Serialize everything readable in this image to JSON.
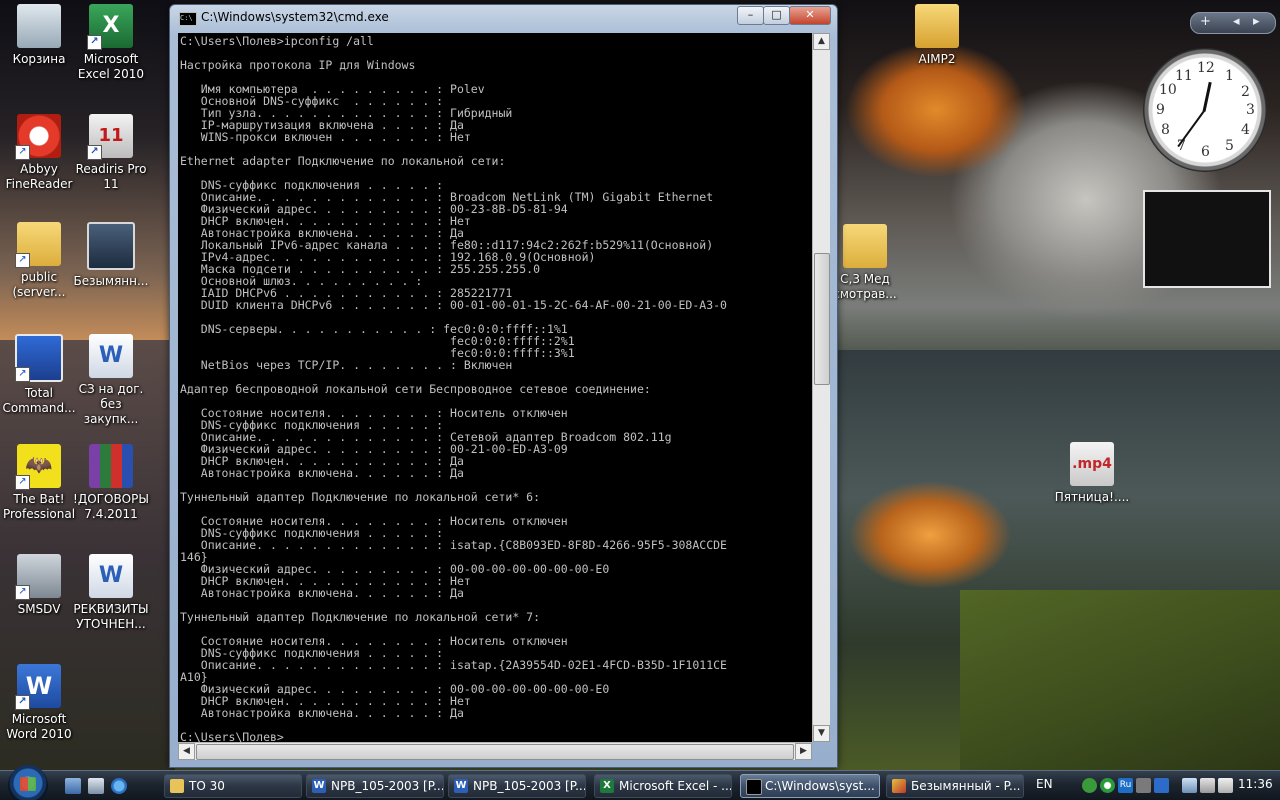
{
  "desktop": {
    "icons_left": [
      {
        "label": "Корзина"
      },
      {
        "label": "Microsoft Excel 2010"
      },
      {
        "label": "Abbyy FineReader"
      },
      {
        "label": "Readiris Pro 11"
      },
      {
        "label": "public (server..."
      },
      {
        "label": "Безымянн..."
      },
      {
        "label": "Total Command..."
      },
      {
        "label": "СЗ на дог. без закупк..."
      },
      {
        "label": "The Bat! Professional"
      },
      {
        "label": "!ДОГОВОРЫ 7.4.2011"
      },
      {
        "label": "SMSDV"
      },
      {
        "label": "РЕКВИЗИТЫ УТОЧНЕН..."
      },
      {
        "label": "Microsoft Word 2010"
      }
    ],
    "icons_right": [
      {
        "label": "AIMP2"
      },
      {
        "label": "С,3 Мед смотрав..."
      },
      {
        "label": "Пятница!...."
      }
    ],
    "media_badge": ".mp4"
  },
  "clock": {
    "numbers": [
      "12",
      "1",
      "2",
      "3",
      "4",
      "5",
      "6",
      "7",
      "8",
      "9",
      "10",
      "11"
    ],
    "time": "11:36"
  },
  "window": {
    "title": "C:\\Windows\\system32\\cmd.exe",
    "buttons": {
      "minimize": "–",
      "maximize": "□",
      "close": "✕"
    },
    "console_text": "C:\\Users\\Полев>ipconfig /all\n\nНастройка протокола IP для Windows\n\n   Имя компьютера  . . . . . . . . . : Polev\n   Основной DNS-суффикс  . . . . . . :\n   Тип узла. . . . . . . . . . . . . : Гибридный\n   IP-маршрутизация включена . . . . : Да\n   WINS-прокси включен . . . . . . . : Нет\n\nEthernet adapter Подключение по локальной сети:\n\n   DNS-суффикс подключения . . . . . :\n   Описание. . . . . . . . . . . . . : Broadcom NetLink (TM) Gigabit Ethernet\n   Физический адрес. . . . . . . . . : 00-23-8B-D5-81-94\n   DHCP включен. . . . . . . . . . . : Нет\n   Автонастройка включена. . . . . . : Да\n   Локальный IPv6-адрес канала . . . : fe80::d117:94c2:262f:b529%11(Основной)\n   IPv4-адрес. . . . . . . . . . . . : 192.168.0.9(Основной)\n   Маска подсети . . . . . . . . . . : 255.255.255.0\n   Основной шлюз. . . . . . . . . :\n   IAID DHCPv6 . . . . . . . . . . . : 285221771\n   DUID клиента DHCPv6 . . . . . . . : 00-01-00-01-15-2C-64-AF-00-21-00-ED-A3-0\n\n   DNS-серверы. . . . . . . . . . . : fec0:0:0:ffff::1%1\n                                       fec0:0:0:ffff::2%1\n                                       fec0:0:0:ffff::3%1\n   NetBios через TCP/IP. . . . . . . . : Включен\n\nАдаптер беспроводной локальной сети Беспроводное сетевое соединение:\n\n   Состояние носителя. . . . . . . . : Носитель отключен\n   DNS-суффикс подключения . . . . . :\n   Описание. . . . . . . . . . . . . : Сетевой адаптер Broadcom 802.11g\n   Физический адрес. . . . . . . . . : 00-21-00-ED-A3-09\n   DHCP включен. . . . . . . . . . . : Да\n   Автонастройка включена. . . . . . : Да\n\nТуннельный адаптер Подключение по локальной сети* 6:\n\n   Состояние носителя. . . . . . . . : Носитель отключен\n   DNS-суффикс подключения . . . . . :\n   Описание. . . . . . . . . . . . . : isatap.{C8B093ED-8F8D-4266-95F5-308ACCDE\n146}\n   Физический адрес. . . . . . . . . : 00-00-00-00-00-00-00-E0\n   DHCP включен. . . . . . . . . . . : Нет\n   Автонастройка включена. . . . . . : Да\n\nТуннельный адаптер Подключение по локальной сети* 7:\n\n   Состояние носителя. . . . . . . . : Носитель отключен\n   DNS-суффикс подключения . . . . . :\n   Описание. . . . . . . . . . . . . : isatap.{2A39554D-02E1-4FCD-B35D-1F1011CE\nA10}\n   Физический адрес. . . . . . . . . : 00-00-00-00-00-00-00-E0\n   DHCP включен. . . . . . . . . . . : Нет\n   Автонастройка включена. . . . . . : Да\n\nC:\\Users\\Полев>_"
  },
  "taskbar": {
    "tasks": [
      {
        "label": "TO 30",
        "icon": "folder-icon"
      },
      {
        "label": "NPB_105-2003 [P...",
        "icon": "word-icon"
      },
      {
        "label": "NPB_105-2003 [P...",
        "icon": "word-icon"
      },
      {
        "label": "Microsoft Excel - ...",
        "icon": "excel-icon"
      },
      {
        "label": "C:\\Windows\\syst...",
        "icon": "cmd-icon"
      },
      {
        "label": "Безымянный - P...",
        "icon": "paint-icon"
      }
    ],
    "language": "EN",
    "tray_badge": "Ru",
    "time": "11:36"
  },
  "colors": {
    "console_bg": "#000000",
    "console_fg": "#c0c0c0",
    "taskbar": "#1c242e"
  }
}
